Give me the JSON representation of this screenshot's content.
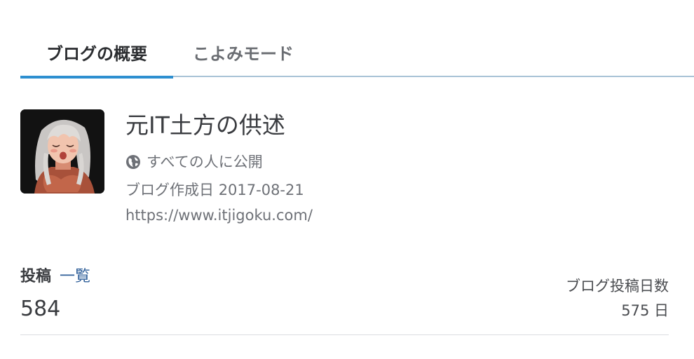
{
  "tabs": [
    {
      "label": "ブログの概要",
      "active": true
    },
    {
      "label": "こよみモード",
      "active": false
    }
  ],
  "blog": {
    "title": "元IT土方の供述",
    "visibility": "すべての人に公開",
    "created_label": "ブログ作成日",
    "created_date": "2017-08-21",
    "url": "https://www.itjigoku.com/",
    "avatar_icon": "character-avatar"
  },
  "stats": {
    "posts_label": "投稿",
    "posts_list_link": "一覧",
    "posts_count": "584",
    "days_label": "ブログ投稿日数",
    "days_value": "575 日"
  },
  "colors": {
    "accent": "#2d8fd0",
    "link": "#2f5f99",
    "tab_border": "#a9c3d6"
  }
}
